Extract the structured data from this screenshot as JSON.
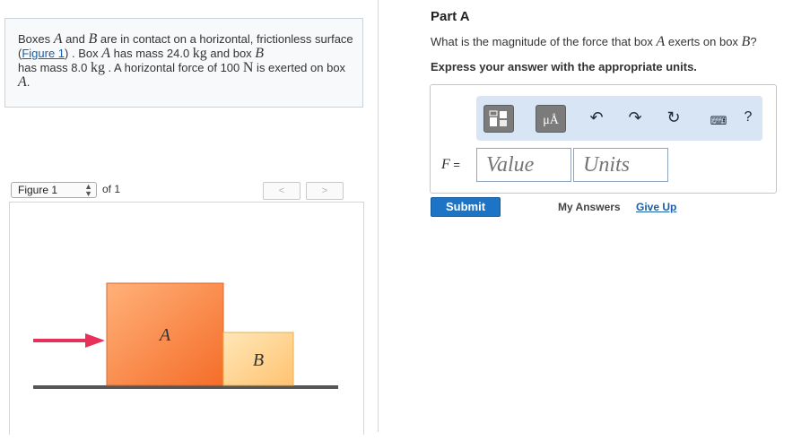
{
  "problem": {
    "text_1": "Boxes ",
    "box_a": "A",
    "text_2": " and ",
    "box_b": "B",
    "text_3": " are in contact on a horizontal, frictionless surface (",
    "figure_link": "Figure 1",
    "text_4": ") . Box ",
    "box_a_2": "A",
    "text_5": " has mass 24.0 ",
    "unit_kg": "kg",
    "text_6": " and box ",
    "box_b_2": "B",
    "text_7": " has mass 8.0 ",
    "unit_kg_2": "kg",
    "text_8": " . A horizontal force of 100 ",
    "unit_n": "N",
    "text_9": " is exerted on box ",
    "box_a_3": "A",
    "text_10": "."
  },
  "figure_nav": {
    "selected": "Figure 1",
    "of_label": "of 1",
    "prev": "<",
    "next": ">"
  },
  "figure": {
    "label_a": "A",
    "label_b": "B",
    "colors": {
      "box": "#f7874a",
      "box_light": "#ffd69a",
      "arrow": "#e8315a",
      "floor": "#555555"
    }
  },
  "part": {
    "title": "Part A",
    "question_1": "What is the magnitude of the force that box ",
    "question_a": "A",
    "question_2": " exerts on box ",
    "question_b": "B",
    "question_3": "?",
    "instruction": "Express your answer with the appropriate units."
  },
  "answer": {
    "field_label_var": "F",
    "field_label_eq": " =",
    "value_placeholder": "Value",
    "units_placeholder": "Units",
    "toolbar": {
      "templates_icon": "templates-icon",
      "units_icon_text": "μÅ",
      "undo_icon": "undo-icon",
      "redo_icon": "redo-icon",
      "reset_icon": "reset-icon",
      "keyboard_icon": "keyboard-icon",
      "help_label": "?"
    }
  },
  "actions": {
    "submit": "Submit",
    "my_answers": "My Answers",
    "give_up": "Give Up"
  }
}
